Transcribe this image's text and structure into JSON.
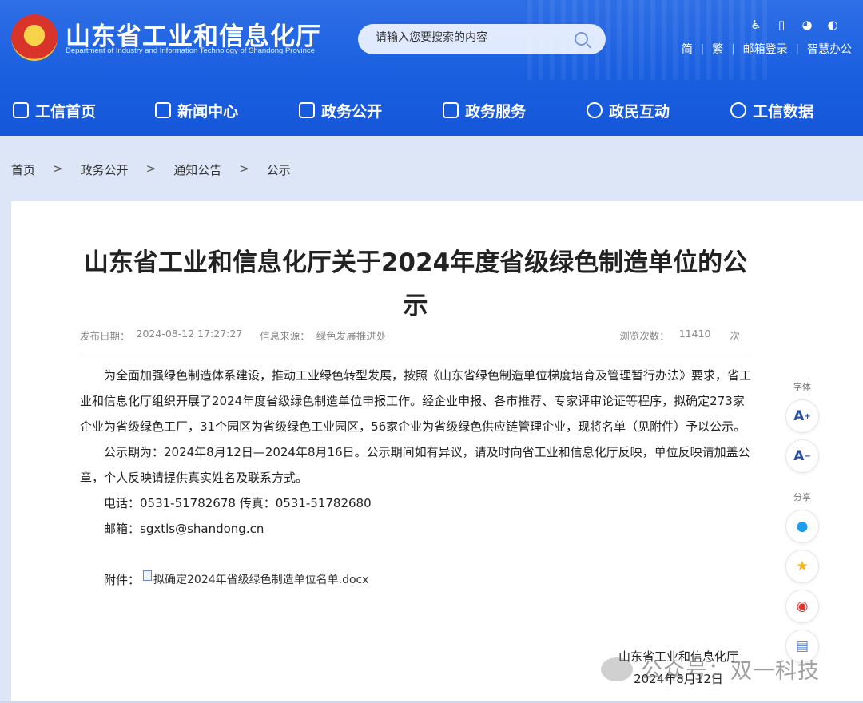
{
  "header": {
    "site_title": "山东省工业和信息化厅",
    "site_subtitle": "Department of Industry and Information Technology of Shandong Province",
    "search_placeholder": "请输入您要搜索的内容",
    "tools": [
      "accessibility-icon",
      "mobile-icon",
      "wechat-icon",
      "weibo-icon"
    ],
    "links": [
      "简",
      "繁",
      "邮箱登录",
      "智慧办公"
    ]
  },
  "nav": [
    {
      "label": "工信首页",
      "icon": "home-icon"
    },
    {
      "label": "新闻中心",
      "icon": "news-icon"
    },
    {
      "label": "政务公开",
      "icon": "monitor-icon"
    },
    {
      "label": "政务服务",
      "icon": "service-icon"
    },
    {
      "label": "政民互动",
      "icon": "chat-icon"
    },
    {
      "label": "工信数据",
      "icon": "database-icon"
    }
  ],
  "breadcrumb": [
    "首页",
    ">",
    "政务公开",
    ">",
    "通知公告",
    ">",
    "公示"
  ],
  "article": {
    "title": "山东省工业和信息化厅关于2024年度省级绿色制造单位的公示",
    "publish_label": "发布日期：",
    "publish_date": "2024-08-12 17:27:27",
    "source_label": "信息来源：",
    "source": "绿色发展推进处",
    "views_label": "浏览次数：",
    "views": "11410",
    "views_unit": "次",
    "paragraphs": [
      "为全面加强绿色制造体系建设，推动工业绿色转型发展，按照《山东省绿色制造单位梯度培育及管理暂行办法》要求，省工业和信息化厅组织开展了2024年度省级绿色制造单位申报工作。经企业申报、各市推荐、专家评审论证等程序，拟确定273家企业为省级绿色工厂，31个园区为省级绿色工业园区，56家企业为省级绿色供应链管理企业，现将名单（见附件）予以公示。",
      "公示期为：2024年8月12日—2024年8月16日。公示期间如有异议，请及时向省工业和信息化厅反映，单位反映请加盖公章，个人反映请提供真实姓名及联系方式。"
    ],
    "phone": "电话：0531-51782678  传真：0531-51782680",
    "email": "邮箱：sgxtls@shandong.cn",
    "attachment_label": "附件：",
    "attachment_name": "拟确定2024年省级绿色制造单位名单.docx",
    "signature_org": "山东省工业和信息化厅",
    "signature_date": "2024年8月12日"
  },
  "side": {
    "font_label": "字体",
    "font_up": "A",
    "font_down": "A",
    "share_label": "分享",
    "share_icons": [
      "qq-icon",
      "qzone-icon",
      "weibo-icon",
      "print-icon"
    ]
  },
  "watermark": "公众号：双一科技",
  "colors": {
    "header_blue": "#1a5fe0",
    "page_bg": "#dde6f7"
  }
}
